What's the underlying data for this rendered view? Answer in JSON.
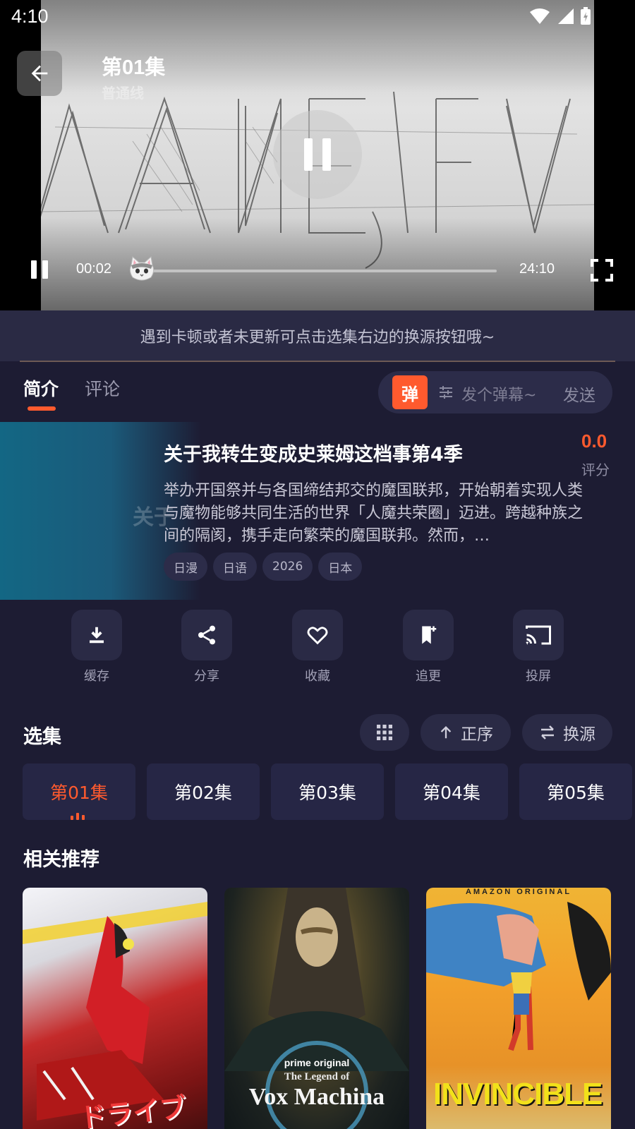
{
  "status_bar": {
    "time": "4:10"
  },
  "player": {
    "episode_title": "第01集",
    "line_name": "普通线",
    "current_time": "00:02",
    "total_time": "24:10",
    "progress": 0.0014,
    "video_text": "BANEV"
  },
  "notice": "遇到卡顿或者未更新可点击选集右边的换源按钮哦~",
  "tabs": [
    {
      "label": "简介",
      "active": true
    },
    {
      "label": "评论",
      "active": false
    }
  ],
  "danmu": {
    "badge": "弹",
    "placeholder": "发个弹幕~",
    "send": "发送"
  },
  "show": {
    "cover_text": "关于",
    "title": "关于我转生变成史莱姆这档事第4季",
    "score": "0.0",
    "score_label": "评分",
    "synopsis": "举办开国祭并与各国缔结邦交的魔国联邦，开始朝着实现人类与魔物能够共同生活的世界「人魔共荣圈」迈进。跨越种族之间的隔阂，携手走向繁荣的魔国联邦。然而，…",
    "tags": [
      "日漫",
      "日语",
      "2026",
      "日本"
    ]
  },
  "actions": [
    {
      "label": "缓存",
      "icon": "download-icon"
    },
    {
      "label": "分享",
      "icon": "share-icon"
    },
    {
      "label": "收藏",
      "icon": "heart-icon"
    },
    {
      "label": "追更",
      "icon": "bookmark-add-icon"
    },
    {
      "label": "投屏",
      "icon": "cast-icon"
    }
  ],
  "episodes_section": {
    "title": "选集",
    "order_label": "正序",
    "source_label": "换源",
    "episodes": [
      {
        "label": "第01集",
        "active": true
      },
      {
        "label": "第02集",
        "active": false
      },
      {
        "label": "第03集",
        "active": false
      },
      {
        "label": "第04集",
        "active": false
      },
      {
        "label": "第05集",
        "active": false
      }
    ]
  },
  "recommend": {
    "title": "相关推荐",
    "posters": [
      {
        "text": "ドライブ"
      },
      {
        "text": "Vox Machina",
        "top_text": "prime original",
        "sub_text": "The Legend of"
      },
      {
        "text": "INVINCIBLE",
        "top_text": "AMAZON ORIGINAL"
      }
    ]
  },
  "colors": {
    "accent": "#ff5a2e",
    "background": "#1d1c33",
    "card": "#262645"
  }
}
